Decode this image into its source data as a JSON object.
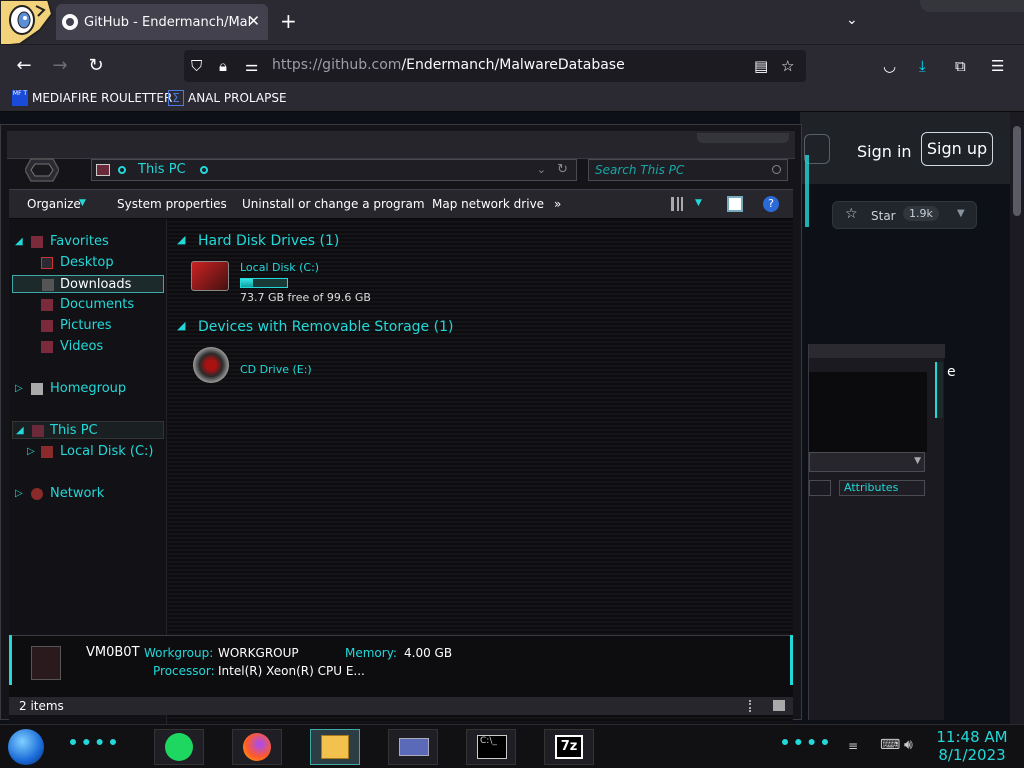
{
  "browser": {
    "tab_title": "GitHub - Endermanch/MalwareDatabase",
    "url_host": "https://github.com",
    "url_path": "/Endermanch/MalwareDatabase",
    "bookmarks": [
      {
        "label": "MEDIAFIRE ROULETTER",
        "icon": "mediafire-icon"
      },
      {
        "label": "ANAL PROLAPSE",
        "icon": "bookmark-sigma-icon"
      }
    ]
  },
  "github": {
    "sign_in": "Sign in",
    "sign_up": "Sign up",
    "star_label": "Star",
    "star_count": "1.9k"
  },
  "explorer": {
    "address": "This PC",
    "search_placeholder": "Search This PC",
    "commands": [
      "Organize",
      "System properties",
      "Uninstall or change a program",
      "Map network drive",
      "»"
    ],
    "nav": {
      "favorites": "Favorites",
      "desktop": "Desktop",
      "downloads": "Downloads",
      "documents": "Documents",
      "pictures": "Pictures",
      "videos": "Videos",
      "homegroup": "Homegroup",
      "this_pc": "This PC",
      "local_disk": "Local Disk (C:)",
      "network": "Network"
    },
    "groups": {
      "hdd": "Hard Disk Drives (1)",
      "removable": "Devices with Removable Storage (1)"
    },
    "drive_c": {
      "name": "Local Disk (C:)",
      "free": "73.7 GB free of 99.6 GB",
      "used_fraction": 0.26
    },
    "drive_e": {
      "name": "CD Drive (E:)"
    },
    "details": {
      "computer": "VM0B0T",
      "workgroup_label": "Workgroup:",
      "workgroup": "WORKGROUP",
      "memory_label": "Memory:",
      "memory": "4.00 GB",
      "processor_label": "Processor:",
      "processor": "Intel(R) Xeon(R) CPU E..."
    },
    "status": "2 items"
  },
  "background_window": {
    "fragment_char": "e",
    "column": "Attributes"
  },
  "taskbar": {
    "time": "11:48 AM",
    "date": "8/1/2023",
    "apps": [
      "spotify-icon",
      "firefox-icon",
      "file-explorer-icon",
      "control-panel-icon",
      "cmd-icon",
      "7zip-icon"
    ]
  },
  "colors": {
    "accent": "#23d8d8",
    "browser": "#2b2a33",
    "github_bg": "#0d1117"
  }
}
